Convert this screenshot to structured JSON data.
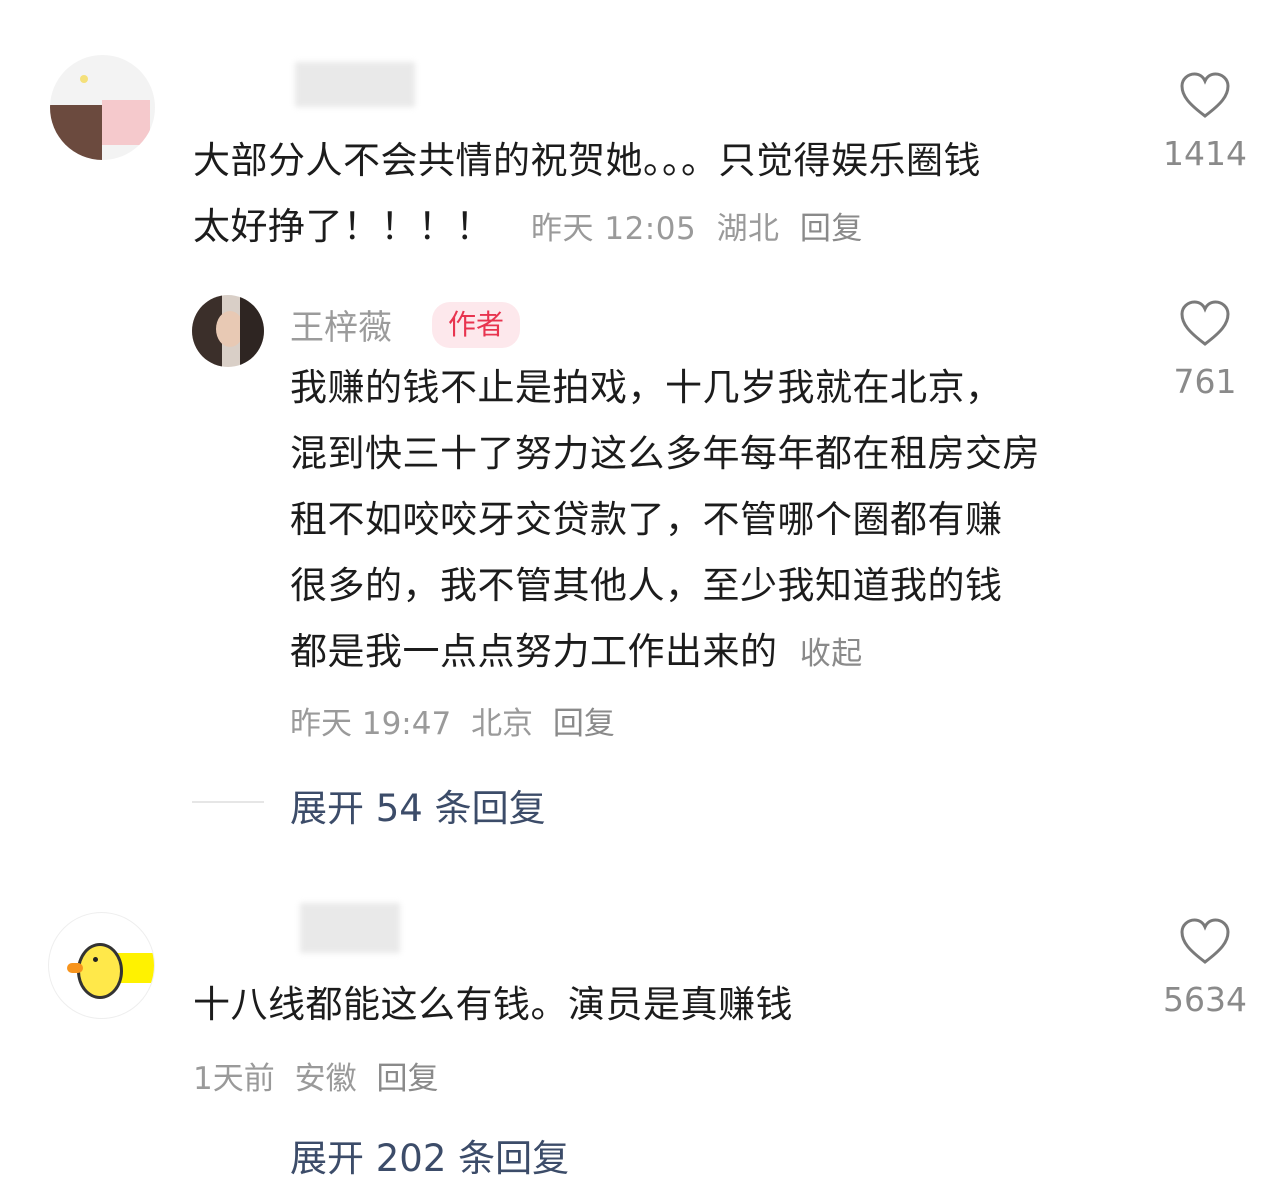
{
  "comments": [
    {
      "text_lines": [
        "大部分人不会共情的祝贺她。。。只觉得娱乐圈钱",
        "太好挣了！！！！"
      ],
      "time": "昨天 12:05",
      "location": "湖北",
      "reply_label": "回复",
      "like_count": "1414"
    },
    {
      "username": "王梓薇",
      "badge": "作者",
      "text_lines": [
        "我赚的钱不止是拍戏，十几岁我就在北京，",
        "混到快三十了努力这么多年每年都在租房交房",
        "租不如咬咬牙交贷款了，不管哪个圈都有赚",
        "很多的，我不管其他人，至少我知道我的钱",
        "都是我一点点努力工作出来的"
      ],
      "collapse_label": "收起",
      "time": "昨天 19:47",
      "location": "北京",
      "reply_label": "回复",
      "like_count": "761"
    },
    {
      "text": "十八线都能这么有钱。演员是真赚钱",
      "time": "1天前",
      "location": "安徽",
      "reply_label": "回复",
      "like_count": "5634"
    }
  ],
  "expand_replies": {
    "first": "展开 54 条回复",
    "second": "展开 202 条回复"
  },
  "colors": {
    "badge_bg": "#fde8ec",
    "badge_text": "#e8344f",
    "expand_link": "#3c4c69",
    "muted": "#9a9a9a"
  },
  "icons": {
    "like": "heart-outline-icon"
  }
}
